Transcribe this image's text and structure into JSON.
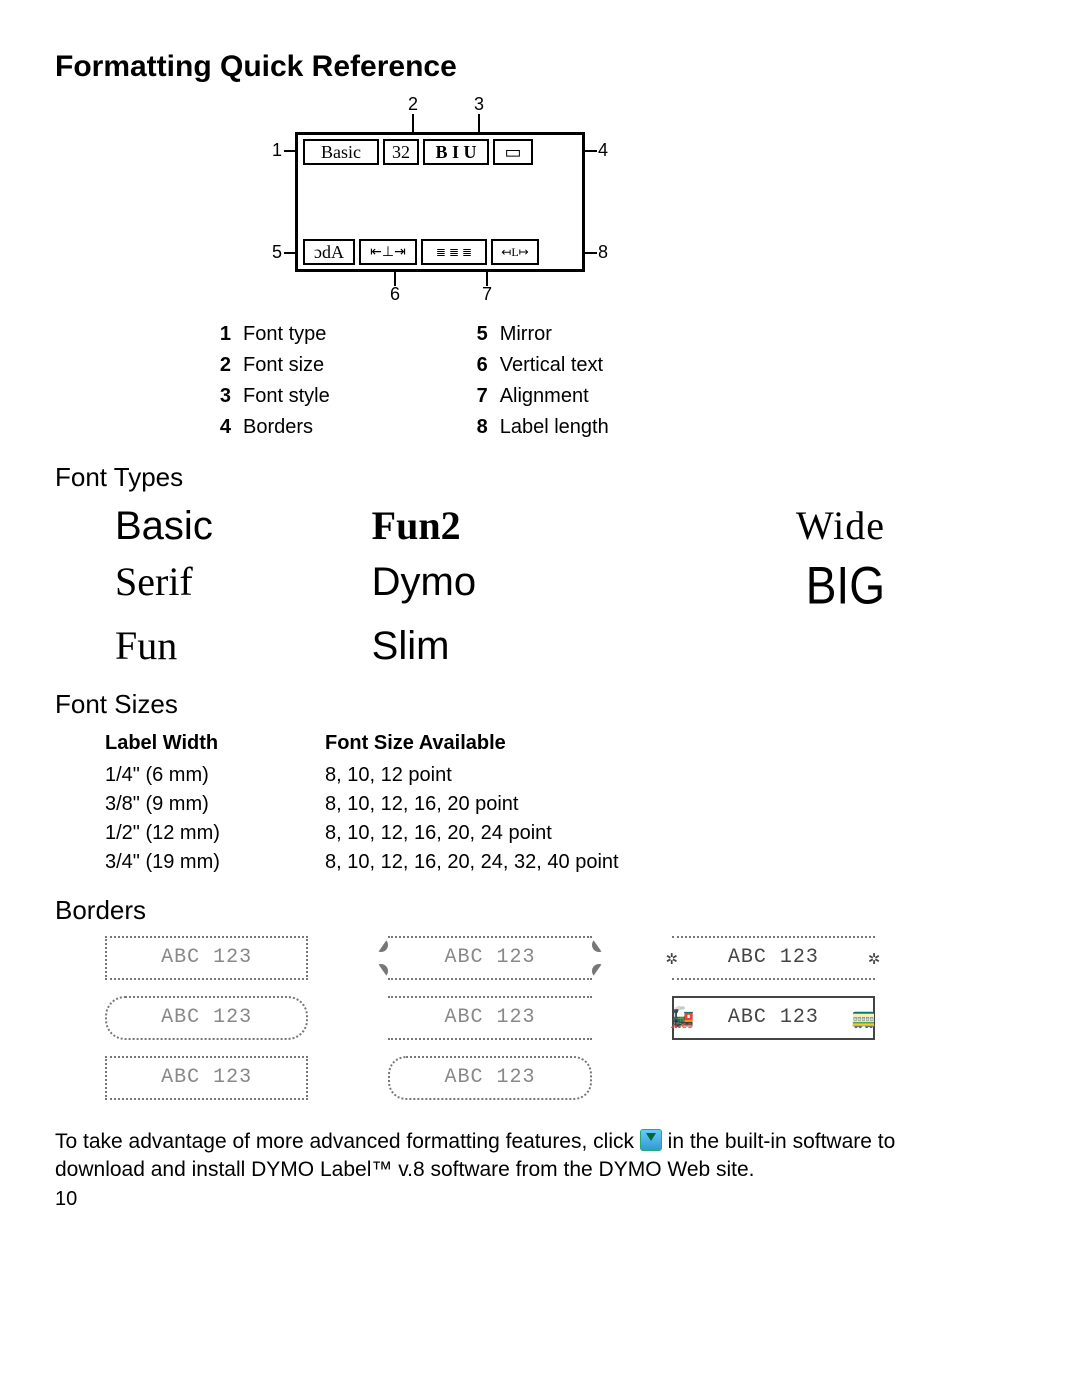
{
  "title": "Formatting Quick Reference",
  "diagram": {
    "callouts": [
      "1",
      "2",
      "3",
      "4",
      "5",
      "6",
      "7",
      "8"
    ],
    "top_cells": {
      "font_type": "Basic",
      "font_size": "32",
      "font_style": "B I U",
      "borders_icon": "▭"
    },
    "bottom_cells": {
      "mirror": "ɔdA",
      "vertical": "⇤⊥⇥",
      "align": "≣ ≣ ≣",
      "length": "↤L↦"
    }
  },
  "legend": [
    {
      "n": "1",
      "label": "Font type"
    },
    {
      "n": "2",
      "label": "Font size"
    },
    {
      "n": "3",
      "label": "Font style"
    },
    {
      "n": "4",
      "label": "Borders"
    },
    {
      "n": "5",
      "label": "Mirror"
    },
    {
      "n": "6",
      "label": "Vertical text"
    },
    {
      "n": "7",
      "label": "Alignment"
    },
    {
      "n": "8",
      "label": "Label length"
    }
  ],
  "sections": {
    "font_types": "Font Types",
    "font_sizes": "Font Sizes",
    "borders": "Borders"
  },
  "font_type_samples": [
    "Basic",
    "Serif",
    "Fun",
    "Fun2",
    "Dymo",
    "Slim",
    "Wide",
    "BIG"
  ],
  "font_size_table": {
    "headers": [
      "Label Width",
      "Font Size Available"
    ],
    "rows": [
      [
        "1/4\" (6 mm)",
        "8, 10, 12 point"
      ],
      [
        "3/8\" (9 mm)",
        "8, 10, 12, 16, 20 point"
      ],
      [
        "1/2\" (12 mm)",
        "8, 10, 12, 16, 20, 24 point"
      ],
      [
        "3/4\" (19 mm)",
        "8, 10, 12, 16, 20, 24, 32, 40 point"
      ]
    ]
  },
  "border_sample_text": "ABC 123",
  "border_styles": [
    "rectangle-dotted",
    "rounded-dotted",
    "pointed-dotted",
    "pointed-solid",
    "scroll",
    "speech-bubble",
    "flower-ends",
    "train-ends"
  ],
  "footer_note_pre": "To take advantage of more advanced formatting features, click ",
  "footer_note_post": " in the built-in software to download and install DYMO Label™ v.8 software from the DYMO Web site.",
  "page_number": "10"
}
